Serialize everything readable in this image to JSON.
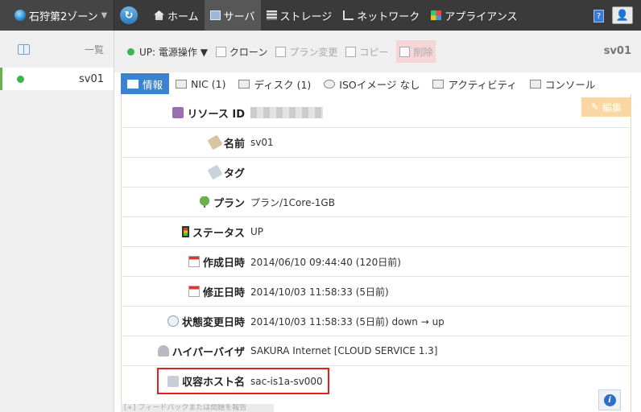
{
  "topbar": {
    "zone": "石狩第2ゾーン",
    "nav": [
      {
        "label": "ホーム",
        "icon": "home-icon"
      },
      {
        "label": "サーバ",
        "icon": "server-icon",
        "active": true
      },
      {
        "label": "ストレージ",
        "icon": "storage-icon"
      },
      {
        "label": "ネットワーク",
        "icon": "network-icon"
      },
      {
        "label": "アプライアンス",
        "icon": "appliance-icon"
      }
    ],
    "help_label": "?"
  },
  "sidebar": {
    "header_label": "一覧",
    "items": [
      {
        "label": "sv01",
        "status_color": "#39b54a"
      }
    ]
  },
  "actions": {
    "power": "UP: 電源操作 ▼",
    "clone": "クローン",
    "plan_change": "プラン変更",
    "copy": "コピー",
    "delete": "削除",
    "server_name": "sv01"
  },
  "tabs": [
    {
      "label": "情報",
      "active": true
    },
    {
      "label": "NIC (1)"
    },
    {
      "label": "ディスク (1)"
    },
    {
      "label": "ISOイメージ なし"
    },
    {
      "label": "アクティビティ"
    },
    {
      "label": "コンソール"
    }
  ],
  "edit_label": "編集",
  "details": [
    {
      "label": "リソース ID",
      "value": "",
      "icon": "id-icon"
    },
    {
      "label": "名前",
      "value": "sv01",
      "icon": "name-tag-icon"
    },
    {
      "label": "タグ",
      "value": "",
      "icon": "tag-icon"
    },
    {
      "label": "プラン",
      "value": "プラン/1Core-1GB",
      "icon": "tree-icon"
    },
    {
      "label": "ステータス",
      "value": "UP",
      "icon": "traffic-light-icon"
    },
    {
      "label": "作成日時",
      "value": "2014/06/10 09:44:40 (120日前)",
      "icon": "calendar-icon"
    },
    {
      "label": "修正日時",
      "value": "2014/10/03 11:58:33 (5日前)",
      "icon": "calendar-icon"
    },
    {
      "label": "状態変更日時",
      "value": "2014/10/03 11:58:33 (5日前) down → up",
      "icon": "clock-icon"
    },
    {
      "label": "ハイパーバイザ",
      "value": "SAKURA Internet [CLOUD SERVICE 1.3]",
      "icon": "hypervisor-icon"
    },
    {
      "label": "収容ホスト名",
      "value": "sac-is1a-sv000",
      "icon": "host-icon"
    }
  ],
  "footer_hint": "[+] フィードバックまたは問題を報告",
  "colors": {
    "accent": "#3b83d0",
    "highlight": "#e32020",
    "status_up": "#39b54a"
  }
}
